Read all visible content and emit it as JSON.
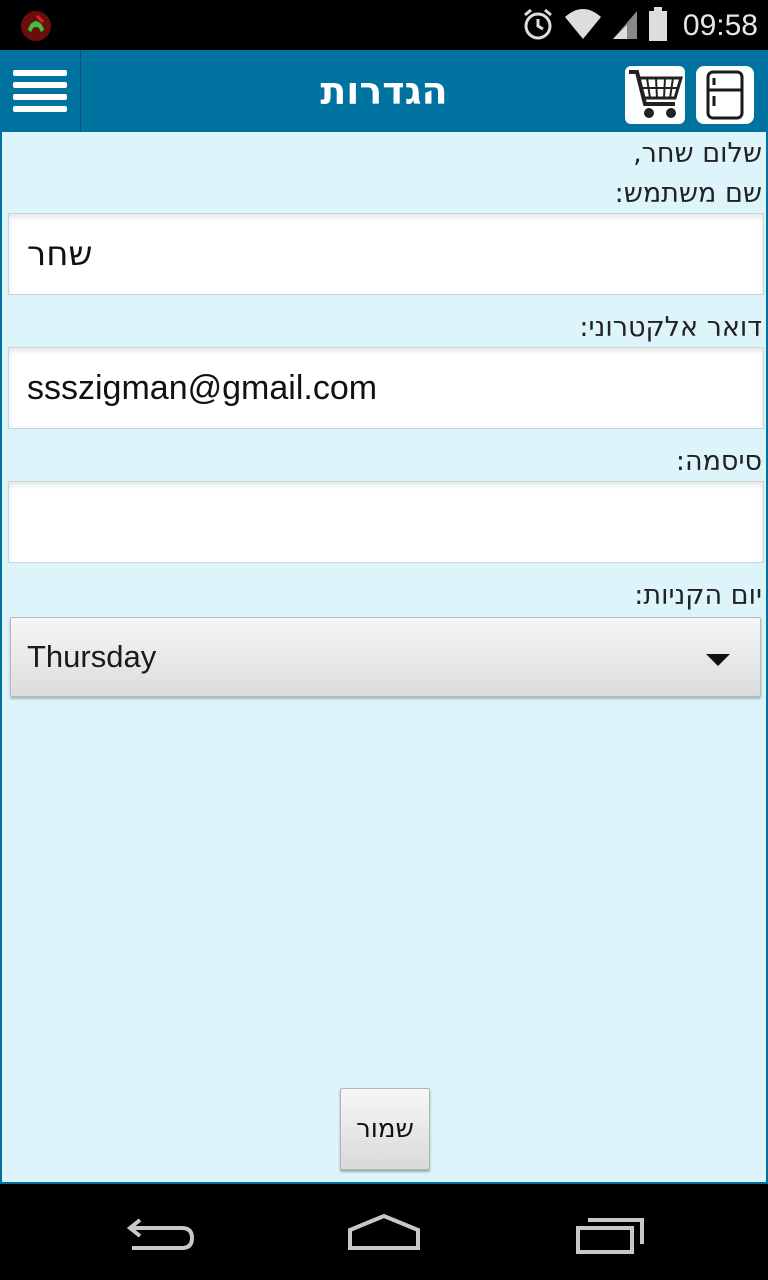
{
  "status_bar": {
    "time": "09:58",
    "icons": [
      "missed-call-icon",
      "alarm-icon",
      "wifi-icon",
      "signal-icon",
      "battery-icon"
    ]
  },
  "action_bar": {
    "title": "הגדרות",
    "menu_icon": "hamburger-menu-icon",
    "cart_icon": "shopping-cart-icon",
    "fridge_icon": "fridge-icon",
    "background_color": "#0072a0"
  },
  "form": {
    "greeting": "שלום שחר,",
    "username_label": "שם משתמש:",
    "username_value": "שחר",
    "email_label": "דואר אלקטרוני:",
    "email_value": "ssszigman@gmail.com",
    "password_label": "סיסמה:",
    "password_value": "",
    "shopping_day_label": "יום הקניות:",
    "shopping_day_value": "Thursday",
    "save_label": "שמור"
  },
  "nav_bar": {
    "icons": [
      "back-icon",
      "home-icon",
      "recent-apps-icon"
    ]
  },
  "colors": {
    "content_background": "#ddf4fa",
    "accent": "#0072a0"
  }
}
